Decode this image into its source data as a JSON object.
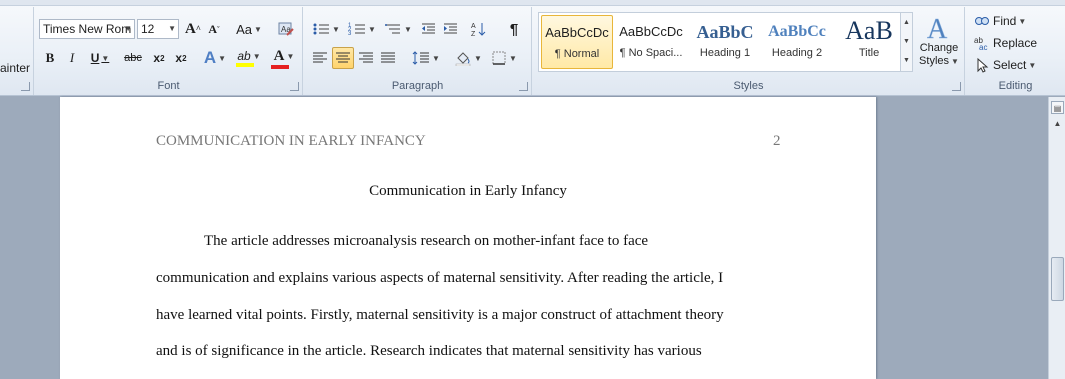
{
  "ribbon": {
    "clipboard": {
      "format_painter_label": "ainter"
    },
    "font": {
      "group_label": "Font",
      "font_name": "Times New Rom",
      "font_size": "12",
      "grow_label": "A",
      "shrink_label": "A",
      "change_case_label": "Aa",
      "bold": "B",
      "italic": "I",
      "underline": "U",
      "strikethrough": "abc",
      "subscript": "x",
      "superscript": "x",
      "effects_label": "A",
      "highlight_label": "ab",
      "font_color_label": "A",
      "highlight_color": "#ffff00",
      "font_color": "#e52020"
    },
    "paragraph": {
      "group_label": "Paragraph",
      "pilcrow": "¶"
    },
    "styles": {
      "group_label": "Styles",
      "tiles": [
        {
          "sample": "AaBbCcDc",
          "name": "¶ Normal",
          "selected": true
        },
        {
          "sample": "AaBbCcDc",
          "name": "¶ No Spaci...",
          "selected": false
        },
        {
          "sample": "AaBbC",
          "name": "Heading 1",
          "selected": false
        },
        {
          "sample": "AaBbCc",
          "name": "Heading 2",
          "selected": false
        },
        {
          "sample": "AaB",
          "name": "Title",
          "selected": false
        }
      ],
      "change_styles_line1": "Change",
      "change_styles_line2": "Styles",
      "heading_color": "#365f91",
      "heading2_color": "#4f81bd",
      "title_color": "#17365d"
    },
    "editing": {
      "group_label": "Editing",
      "find": "Find",
      "replace": "Replace",
      "select": "Select"
    }
  },
  "document": {
    "running_head": "COMMUNICATION IN EARLY INFANCY",
    "page_number": "2",
    "title": "Communication in Early Infancy",
    "lines": [
      "The article addresses microanalysis  research on mother-infant face to face",
      "communication and explains various aspects of maternal sensitivity. After reading the article, I",
      "have learned vital points. Firstly, maternal sensitivity is a major  construct of attachment theory",
      "and is  of significance in the article.  Research indicates that maternal sensitivity has various"
    ]
  }
}
